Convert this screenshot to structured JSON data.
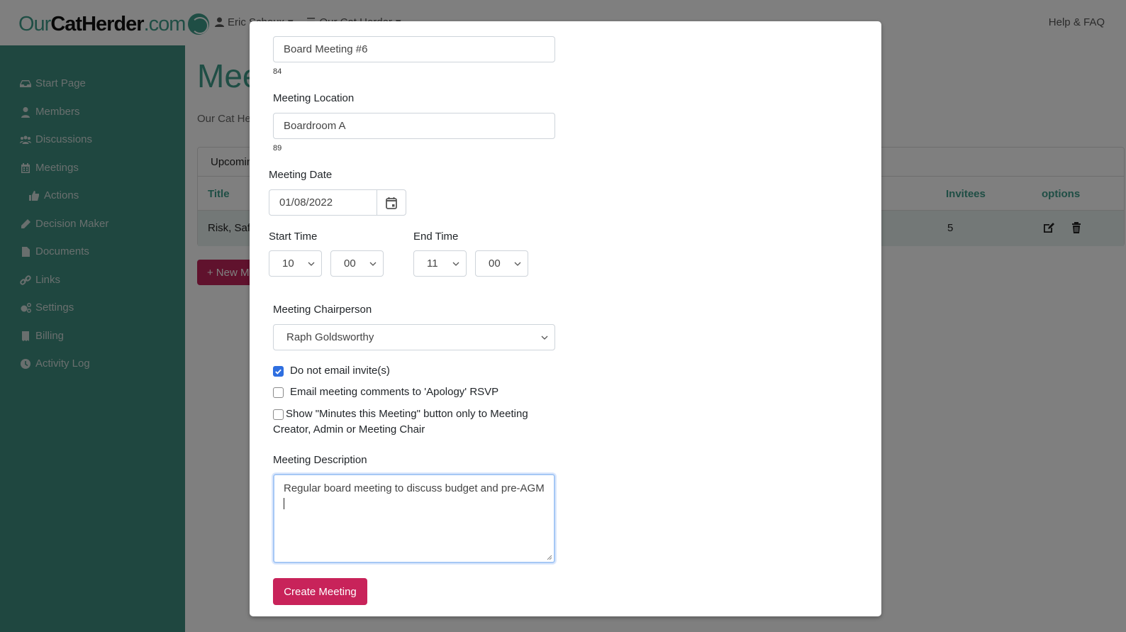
{
  "header": {
    "logo": {
      "our": "Our",
      "cat": "CatHerder",
      "com": ".com"
    },
    "user_menu": "Eric Schoux",
    "org_menu": "Our Cat Herder",
    "help_link": "Help & FAQ"
  },
  "sidebar": {
    "items": [
      {
        "label": "Start Page",
        "icon": "inbox-icon"
      },
      {
        "label": "Members",
        "icon": "user-icon"
      },
      {
        "label": "Discussions",
        "icon": "users-icon"
      },
      {
        "label": "Meetings",
        "icon": "calendar-icon"
      },
      {
        "label": "Actions",
        "icon": "thumbs-up-icon"
      },
      {
        "label": "Decision Maker",
        "icon": "pencil-icon"
      },
      {
        "label": "Documents",
        "icon": "file-icon"
      },
      {
        "label": "Links",
        "icon": "link-icon"
      },
      {
        "label": "Settings",
        "icon": "cogs-icon"
      },
      {
        "label": "Billing",
        "icon": "receipt-icon"
      },
      {
        "label": "Activity Log",
        "icon": "clock-icon"
      }
    ]
  },
  "main": {
    "title": "Meetings",
    "subtitle": "Our Cat Herder",
    "tab_label": "Upcoming",
    "table": {
      "columns": [
        "Title",
        "Invitees",
        "options"
      ],
      "rows": [
        {
          "title": "Risk, Safety",
          "invitees": "5"
        }
      ]
    },
    "new_button": "New Meeting"
  },
  "modal": {
    "title_value": "Board Meeting #6",
    "title_counter": "84",
    "location_label": "Meeting Location",
    "location_value": "Boardroom A",
    "location_counter": "89",
    "date_label": "Meeting Date",
    "date_value": "01/08/2022",
    "start_label": "Start Time",
    "start_hour": "10",
    "start_minute": "00",
    "end_label": "End Time",
    "end_hour": "11",
    "end_minute": "00",
    "chair_label": "Meeting Chairperson",
    "chair_value": "Raph Goldsworthy",
    "checkboxes": [
      {
        "label": "Do not email invite(s)",
        "checked": true
      },
      {
        "label": "Email meeting comments to 'Apology' RSVP",
        "checked": false
      },
      {
        "label": "Show \"Minutes this Meeting\" button only to Meeting Creator, Admin or Meeting Chair",
        "checked": false
      }
    ],
    "description_label": "Meeting Description",
    "description_value": "Regular board meeting to discuss budget and pre-AGM",
    "create_button": "Create Meeting"
  },
  "colors": {
    "brand_teal": "#3f9c8a",
    "sidebar_bg": "#3f8f80",
    "accent_crimson": "#c8235a",
    "checkbox_blue": "#2f6fe0"
  }
}
